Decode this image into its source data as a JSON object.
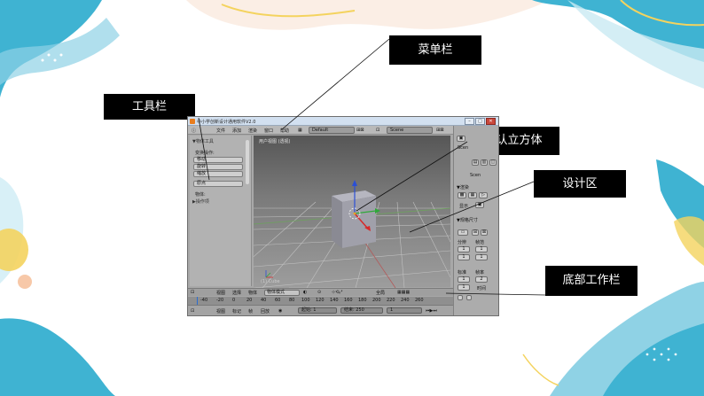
{
  "callouts": {
    "menubar": "菜单栏",
    "toolbar": "工具栏",
    "default_cube": "默认立方体",
    "design_area": "设计区",
    "bottom_bar": "底部工作栏"
  },
  "window": {
    "title": "中小学创新设计通用软件V2.0",
    "close": "✕",
    "maximize": "□",
    "minimize": "–"
  },
  "menubar": {
    "items": [
      "文件",
      "添加",
      "渲染",
      "窗口",
      "帮助"
    ],
    "layout_field": "Default",
    "scene_field": "Scene"
  },
  "tool_panel": {
    "header": "▼物体工具",
    "transform_label": "变换操作:",
    "buttons": [
      "移动",
      "旋转",
      "缩放"
    ],
    "origin_button": "原点",
    "object_label": "物体:",
    "operations": "▶操作项"
  },
  "viewport": {
    "label": "用户视图 (透视)",
    "corner_label": "(1) Cube"
  },
  "properties": {
    "scene": "Scen",
    "render_header": "▼渲染",
    "display": "显示",
    "dimensions_header": "▼规格尺寸",
    "labels": [
      "分辨",
      "帧范",
      "标准",
      "帧率",
      "时间"
    ],
    "fields": [
      "1",
      "1",
      "1",
      "1",
      "2"
    ]
  },
  "header3d": {
    "items": [
      "视图",
      "选择",
      "物体"
    ],
    "mode": "物体模式",
    "global": "全局"
  },
  "timeline": {
    "ticks": [
      "-40",
      "-20",
      "0",
      "20",
      "40",
      "60",
      "80",
      "100",
      "120",
      "140",
      "160",
      "180",
      "200",
      "220",
      "240",
      "260"
    ]
  },
  "bottombar": {
    "items": [
      "视图",
      "标记",
      "帧",
      "回放"
    ],
    "start": "起始: 1",
    "end": "结束: 250",
    "current": "1"
  },
  "colors": {
    "accent_teal": "#3fb3d2",
    "accent_yellow": "#f4d35e",
    "accent_peach": "#f7c8a8",
    "callout_bg": "#000000"
  }
}
